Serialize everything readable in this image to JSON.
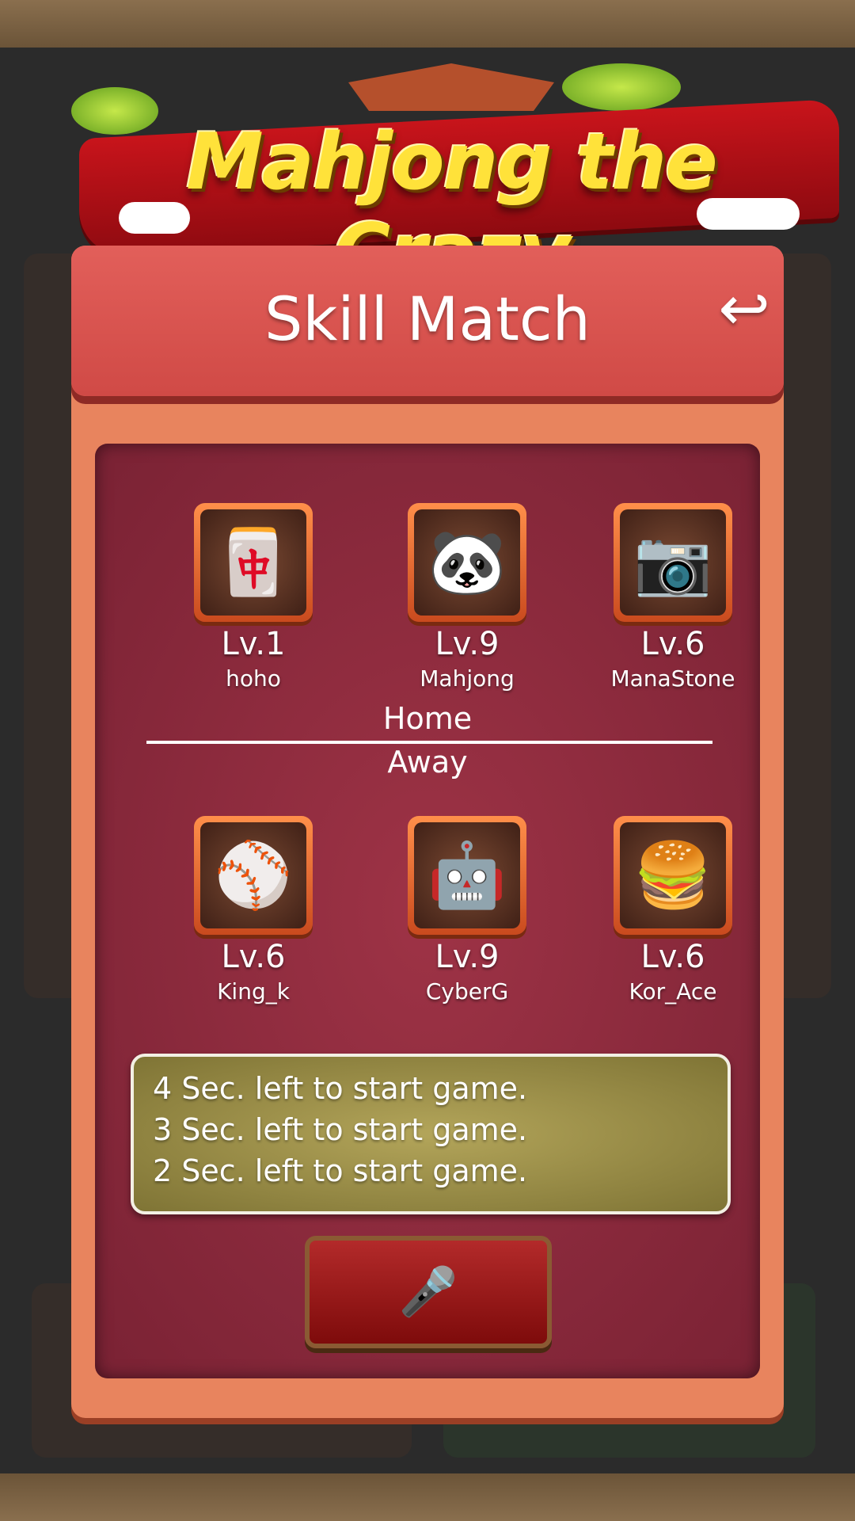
{
  "app": {
    "logo_text": "Mahjong the Crazy"
  },
  "panel": {
    "title": "Skill Match",
    "back_icon": "return-arrow-icon"
  },
  "teams": {
    "home_label": "Home",
    "away_label": "Away",
    "home": [
      {
        "level": "Lv.1",
        "name": "hoho",
        "avatar": "mahjong-tile-character"
      },
      {
        "level": "Lv.9",
        "name": "Mahjong",
        "avatar": "panda-character"
      },
      {
        "level": "Lv.6",
        "name": "ManaStone",
        "avatar": "camera-character"
      }
    ],
    "away": [
      {
        "level": "Lv.6",
        "name": "King_k",
        "avatar": "baseball-character"
      },
      {
        "level": "Lv.9",
        "name": "CyberG",
        "avatar": "robot-character"
      },
      {
        "level": "Lv.6",
        "name": "Kor_Ace",
        "avatar": "burger-character"
      }
    ]
  },
  "messages": [
    "4 Sec. left to start game.",
    "3 Sec. left to start game.",
    "2 Sec. left to start game."
  ],
  "mic_button": {
    "icon": "microphone-icon"
  },
  "colors": {
    "accent_red": "#d04a46",
    "panel": "#e8845e",
    "inner": "#8a2a3c",
    "logo_yellow": "#ffe23a"
  }
}
